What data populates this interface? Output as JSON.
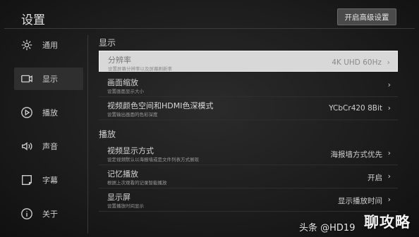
{
  "header": {
    "title": "设置",
    "advanced_button": "开启高级设置"
  },
  "sidebar": {
    "items": [
      {
        "label": "通用",
        "icon": "gear-icon"
      },
      {
        "label": "显示",
        "icon": "display-icon"
      },
      {
        "label": "播放",
        "icon": "play-icon"
      },
      {
        "label": "声音",
        "icon": "speaker-icon"
      },
      {
        "label": "字幕",
        "icon": "subtitle-icon"
      },
      {
        "label": "关于",
        "icon": "info-icon"
      }
    ],
    "active_index": 1
  },
  "sections": {
    "display": {
      "heading": "显示",
      "rows": [
        {
          "title": "分辨率",
          "subtitle": "设置屏幕分辨率以及屏幕刷新率",
          "value": "4K UHD 60Hz"
        },
        {
          "title": "画面缩放",
          "subtitle": "设置画面显示大小",
          "value": ""
        },
        {
          "title": "视频颜色空间和HDMI色深模式",
          "subtitle": "设置输出画面的色彩深度",
          "value": "YCbCr420 8Bit"
        }
      ]
    },
    "playback": {
      "heading": "播放",
      "rows": [
        {
          "title": "视频显示方式",
          "subtitle": "设定视频默认以海报墙或是文件列表方式展现",
          "value": "海报墙方式优先"
        },
        {
          "title": "记忆播放",
          "subtitle": "根据上次观看的记录智能播放",
          "value": "开启"
        },
        {
          "title": "显示屏",
          "subtitle": "设置播放时间显示",
          "value": "显示播放时间"
        }
      ]
    }
  },
  "watermark": {
    "text": "头条 @HD19",
    "logo": "聊攻略"
  }
}
